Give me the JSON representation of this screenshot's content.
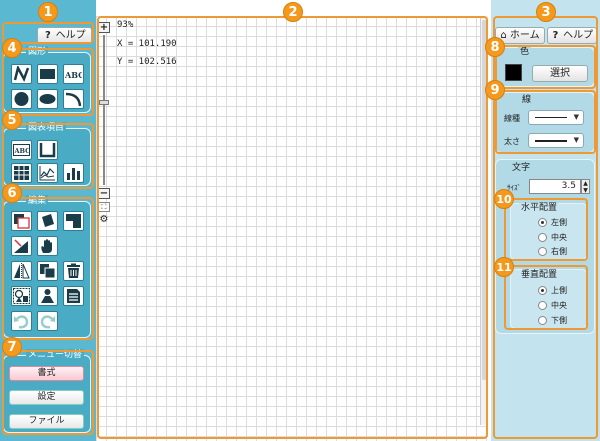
{
  "left_panel": {
    "help_label": "ヘルプ",
    "groups": {
      "shapes": {
        "title": "図形",
        "icons": [
          "freehand-line-icon",
          "filled-rectangle-icon",
          "text-abc-icon",
          "filled-circle-icon",
          "filled-ellipse-icon",
          "arc-icon"
        ]
      },
      "chart_items": {
        "title": "図表項目",
        "icons": [
          "text-box-icon",
          "container-icon",
          "table-grid-icon",
          "line-graph-icon",
          "bar-chart-icon"
        ]
      },
      "edit": {
        "title": "編集",
        "icons": [
          "bring-front-icon",
          "rotate-icon",
          "send-back-icon",
          "resize-icon",
          "hand-pan-icon",
          "flip-icon",
          "copy-icon",
          "trash-icon",
          "group-shapes-icon",
          "ungroup-icon",
          "properties-icon",
          "undo-icon",
          "redo-icon"
        ]
      },
      "menu": {
        "title": "メニュー切替",
        "buttons": [
          "書式",
          "設定",
          "ファイル"
        ]
      }
    }
  },
  "canvas": {
    "zoom_level": "93%",
    "coord_x": "X = 101.190",
    "coord_y": "Y = 102.516",
    "zoom_in_label": "+",
    "zoom_out_label": "−"
  },
  "right_panel": {
    "home_label": "ホーム",
    "help_label": "ヘルプ",
    "color": {
      "title": "色",
      "select_label": "選択",
      "current_color": "#000000"
    },
    "line": {
      "title": "線",
      "type_label": "線種",
      "width_label": "太さ"
    },
    "text": {
      "title": "文字",
      "size_label": "ｻｲｽﾞ",
      "size_value": "3.5",
      "horizontal": {
        "title": "水平配置",
        "options": [
          "左側",
          "中央",
          "右側"
        ],
        "selected": "左側"
      },
      "vertical": {
        "title": "垂直配置",
        "options": [
          "上側",
          "中央",
          "下側"
        ],
        "selected": "上側"
      }
    }
  },
  "callouts": [
    "1",
    "2",
    "3",
    "4",
    "5",
    "6",
    "7",
    "8",
    "9",
    "10",
    "11"
  ],
  "colors": {
    "accent_orange": "#f39a1e",
    "sidebar_blue": "#5ab8d0",
    "right_panel": "#c3e3ee"
  }
}
